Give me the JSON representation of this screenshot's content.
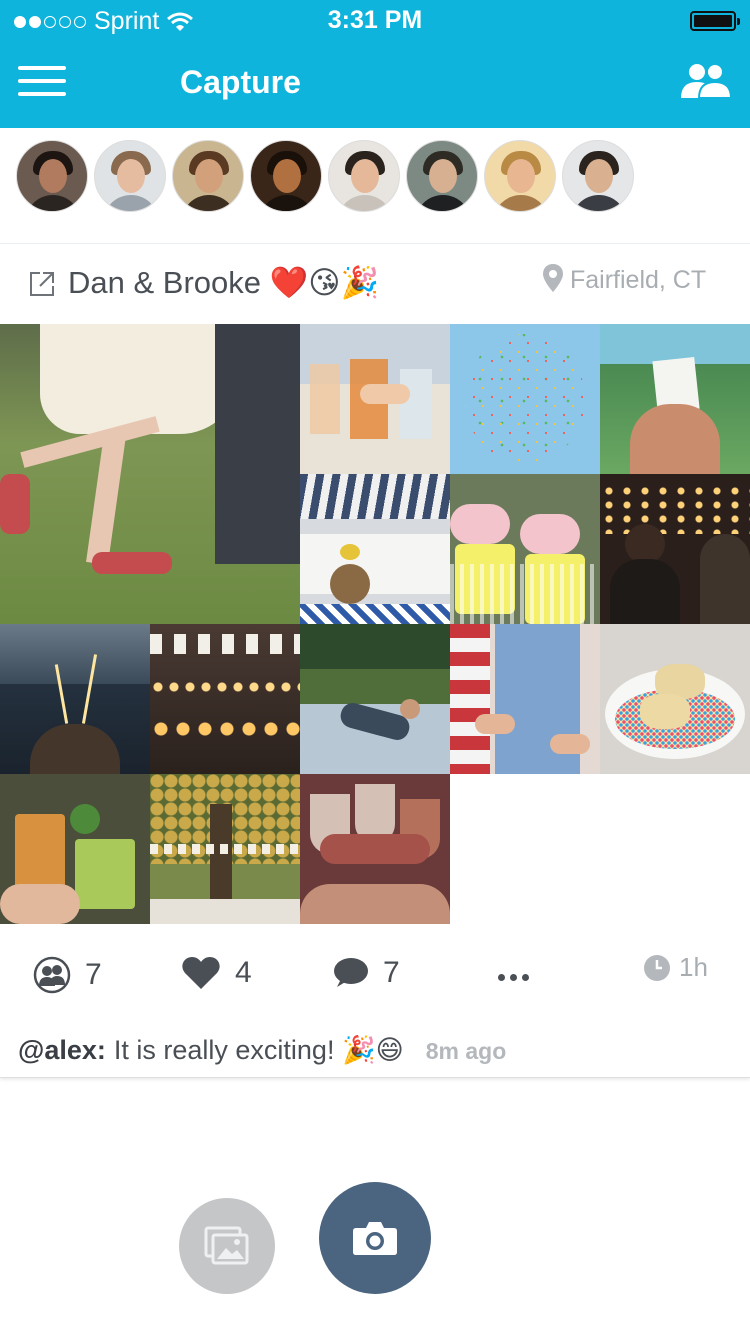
{
  "status_bar": {
    "carrier": "Sprint",
    "time": "3:31 PM",
    "signal_strength": 2
  },
  "header": {
    "title": "Capture",
    "menu_icon": "hamburger-menu-icon",
    "people_icon": "people-icon"
  },
  "colors": {
    "header_bg": "#0fb4dc",
    "camera_button": "#4b6580",
    "gallery_button": "#c4c6c8",
    "text": "#4a4f55",
    "muted": "#a8adb2"
  },
  "members": [
    {
      "name": "member-1"
    },
    {
      "name": "member-2"
    },
    {
      "name": "member-3"
    },
    {
      "name": "member-4"
    },
    {
      "name": "member-5"
    },
    {
      "name": "member-6"
    },
    {
      "name": "member-7"
    },
    {
      "name": "member-8"
    }
  ],
  "album": {
    "title": "Dan & Brooke ❤️😘🎉",
    "location": "Fairfield, CT",
    "photo_count": 16
  },
  "stats": {
    "members": "7",
    "likes": "4",
    "comments": "7",
    "time_left": "1h"
  },
  "latest_comment": {
    "user": "@alex:",
    "text": "It is really exciting! 🎉😄",
    "ago": "8m ago"
  }
}
